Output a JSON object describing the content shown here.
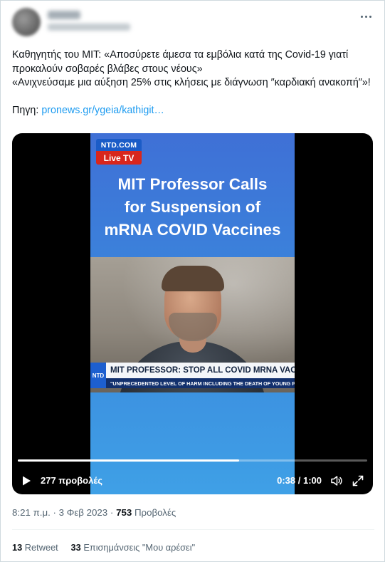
{
  "tweet": {
    "text_line1": "Καθηγητής του MIT: «Αποσύρετε άμεσα τα εμβόλια κατά της Covid-19 γιατί προκαλούν σοβαρές βλάβες στους νέους»",
    "text_line2": "«Ανιχνεύσαμε μια αύξηση 25% στις κλήσεις με διάγνωση ″καρδιακή ανακοπή″»!",
    "source_label": "Πηγη:",
    "source_link": "pronews.gr/ygeia/kathigit…"
  },
  "video": {
    "ntd_top": "NTD.COM",
    "ntd_bottom": "Live TV",
    "headline_1": "MIT Professor Calls",
    "headline_2": "for Suspension of",
    "headline_3": "mRNA COVID Vaccines",
    "lower_logo": "NTD",
    "lower_main": "MIT PROFESSOR: STOP ALL COVID MRNA VACCINES",
    "lower_sub": "\"UNPRECEDENTED LEVEL OF HARM INCLUDING THE DEATH OF YOUNG PEOPLE\"",
    "views": "277 προβολές",
    "time": "0:38 / 1:00",
    "progress": 0.633
  },
  "meta": {
    "time": "8:21 π.μ.",
    "dot1": "·",
    "date": "3 Φεβ 2023",
    "dot2": "·",
    "view_count": "753",
    "views_label": "Προβολές"
  },
  "stats": {
    "retweets_count": "13",
    "retweets_label": "Retweet",
    "likes_count": "33",
    "likes_label": "Επισημάνσεις \"Μου αρέσει\""
  },
  "colors": {
    "link": "#1d9bf0",
    "secondary_text": "#536471",
    "primary_text": "#0f1419"
  },
  "icons": {
    "more": "more-icon",
    "play": "play-icon",
    "volume": "volume-icon",
    "fullscreen": "fullscreen-icon"
  }
}
